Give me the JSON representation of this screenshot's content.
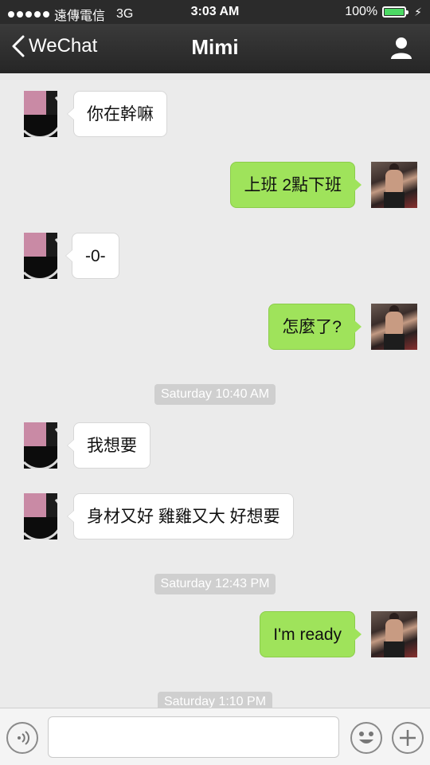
{
  "status_bar": {
    "carrier": "遠傳電信",
    "network": "3G",
    "time": "3:03 AM",
    "battery_percent": "100%",
    "battery_level": 1.0
  },
  "nav": {
    "back_label": "WeChat",
    "title": "Mimi",
    "profile_icon": "person-icon"
  },
  "messages": [
    {
      "side": "left",
      "text": "你在幹嘛"
    },
    {
      "side": "right",
      "text": "上班 2點下班"
    },
    {
      "side": "left",
      "text": "-0-"
    },
    {
      "side": "right",
      "text": "怎麼了?"
    },
    {
      "type": "time",
      "text": "Saturday 10:40 AM"
    },
    {
      "side": "left",
      "text": "我想要"
    },
    {
      "side": "left",
      "text": "身材又好 雞雞又大 好想要"
    },
    {
      "type": "time",
      "text": "Saturday 12:43 PM"
    },
    {
      "side": "right",
      "text": "I'm ready"
    },
    {
      "type": "time",
      "text": "Saturday 1:10 PM"
    }
  ],
  "input_bar": {
    "voice_icon": "voice-icon",
    "emoji_icon": "emoji-icon",
    "plus_icon": "plus-icon",
    "text_value": ""
  },
  "colors": {
    "bubble_sent": "#9fe35b",
    "bubble_received": "#ffffff",
    "chat_background": "#ebebeb",
    "nav_background": "#2b2b2b"
  }
}
